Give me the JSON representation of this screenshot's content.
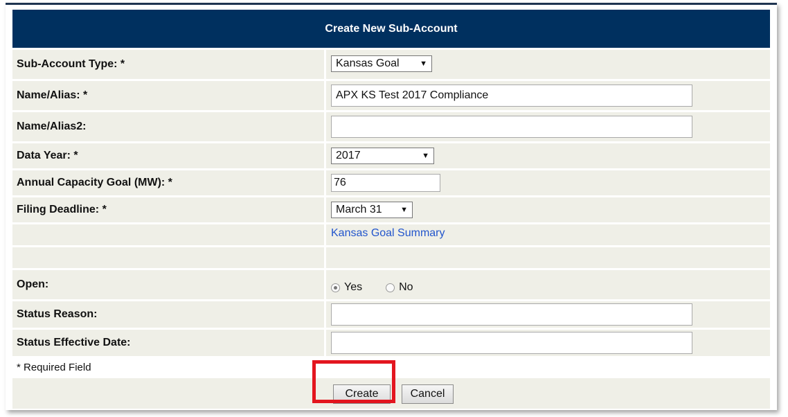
{
  "form": {
    "title": "Create New Sub-Account",
    "fields": {
      "subaccount_type": {
        "label": "Sub-Account Type: *",
        "value": "Kansas Goal"
      },
      "name_alias": {
        "label": "Name/Alias: *",
        "value": "APX KS Test 2017 Compliance"
      },
      "name_alias2": {
        "label": "Name/Alias2:",
        "value": ""
      },
      "data_year": {
        "label": "Data Year: *",
        "value": "2017"
      },
      "capacity_goal": {
        "label": "Annual Capacity Goal (MW): *",
        "value": "76"
      },
      "filing_deadline": {
        "label": "Filing Deadline: *",
        "value": "March 31"
      },
      "summary_link": "Kansas Goal Summary",
      "open": {
        "label": "Open:",
        "yes": "Yes",
        "no": "No",
        "selected": "Yes"
      },
      "status_reason": {
        "label": "Status Reason:",
        "value": ""
      },
      "status_effective_date": {
        "label": "Status Effective Date:",
        "value": ""
      }
    },
    "required_note": "* Required Field",
    "buttons": {
      "create": "Create",
      "cancel": "Cancel"
    }
  },
  "colors": {
    "header": "#00305f",
    "row": "#efefe7",
    "highlight": "#e3161f",
    "link": "#2255cc"
  }
}
